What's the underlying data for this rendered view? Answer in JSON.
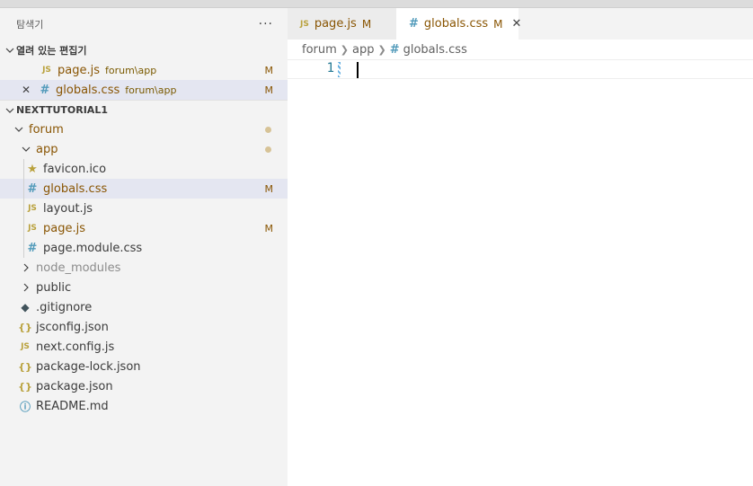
{
  "explorer": {
    "title": "탐색기",
    "more": "···",
    "open_editors": {
      "header": "열려 있는 편집기",
      "items": [
        {
          "icon": "JS",
          "name": "page.js",
          "path": "forum\\app",
          "badge": "M"
        },
        {
          "icon": "#",
          "close": "✕",
          "name": "globals.css",
          "path": "forum\\app",
          "badge": "M"
        }
      ]
    },
    "project": {
      "header": "NEXTTUTORIAL1",
      "tree": {
        "forum": "forum",
        "app": "app",
        "favicon": {
          "icon": "★",
          "name": "favicon.ico"
        },
        "globals": {
          "icon": "#",
          "name": "globals.css",
          "badge": "M"
        },
        "layout": {
          "icon": "JS",
          "name": "layout.js"
        },
        "page": {
          "icon": "JS",
          "name": "page.js",
          "badge": "M"
        },
        "page_module": {
          "icon": "#",
          "name": "page.module.css"
        },
        "node_modules": "node_modules",
        "public": "public",
        "gitignore": {
          "icon": "◆",
          "name": ".gitignore"
        },
        "jsconfig": {
          "icon": "{}",
          "name": "jsconfig.json"
        },
        "next_config": {
          "icon": "JS",
          "name": "next.config.js"
        },
        "package_lock": {
          "icon": "{}",
          "name": "package-lock.json"
        },
        "package": {
          "icon": "{}",
          "name": "package.json"
        },
        "readme": {
          "icon": "ⓘ",
          "name": "README.md"
        }
      }
    }
  },
  "editor": {
    "tabs": [
      {
        "icon": "JS",
        "label": "page.js",
        "badge": "M"
      },
      {
        "icon": "#",
        "label": "globals.css",
        "badge": "M",
        "close": "✕"
      }
    ],
    "breadcrumb": {
      "folder1": "forum",
      "folder2": "app",
      "icon": "#",
      "file": "globals.css"
    },
    "line_number": "1"
  },
  "colors": {
    "modified": "#895503",
    "selection": "#e4e6f1",
    "js_icon": "#b9a13c",
    "css_icon": "#519aba"
  }
}
